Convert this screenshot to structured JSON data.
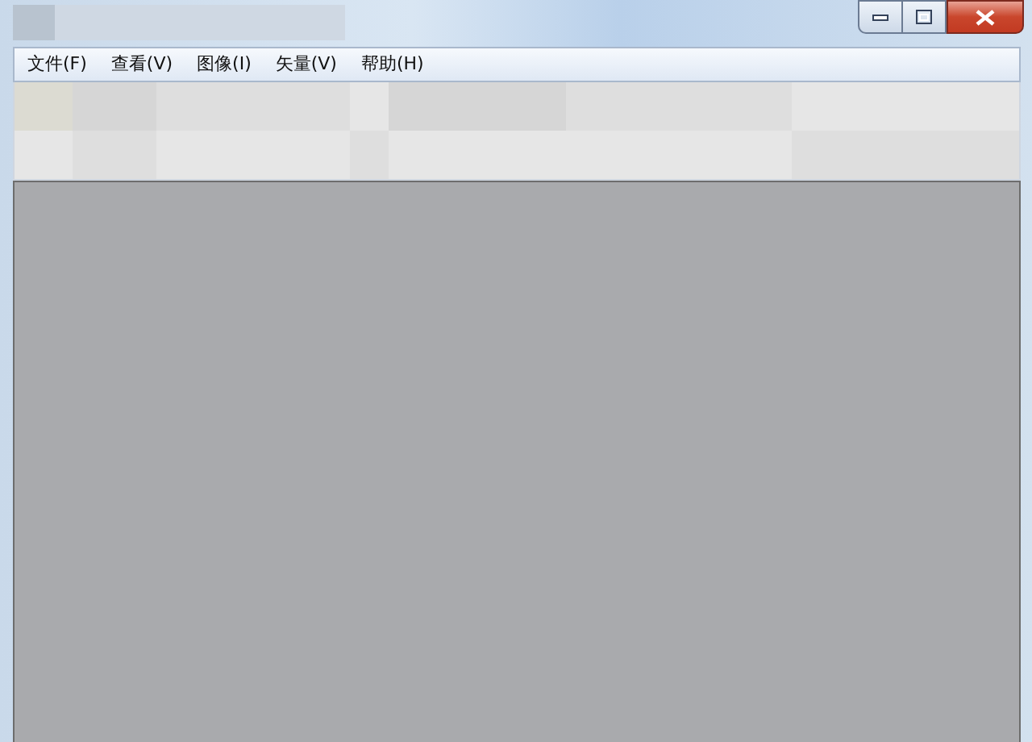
{
  "menu_bar": {
    "items": [
      {
        "label": "文件(F)"
      },
      {
        "label": "查看(V)"
      },
      {
        "label": "图像(I)"
      },
      {
        "label": "矢量(V)"
      },
      {
        "label": "帮助(H)"
      }
    ]
  }
}
